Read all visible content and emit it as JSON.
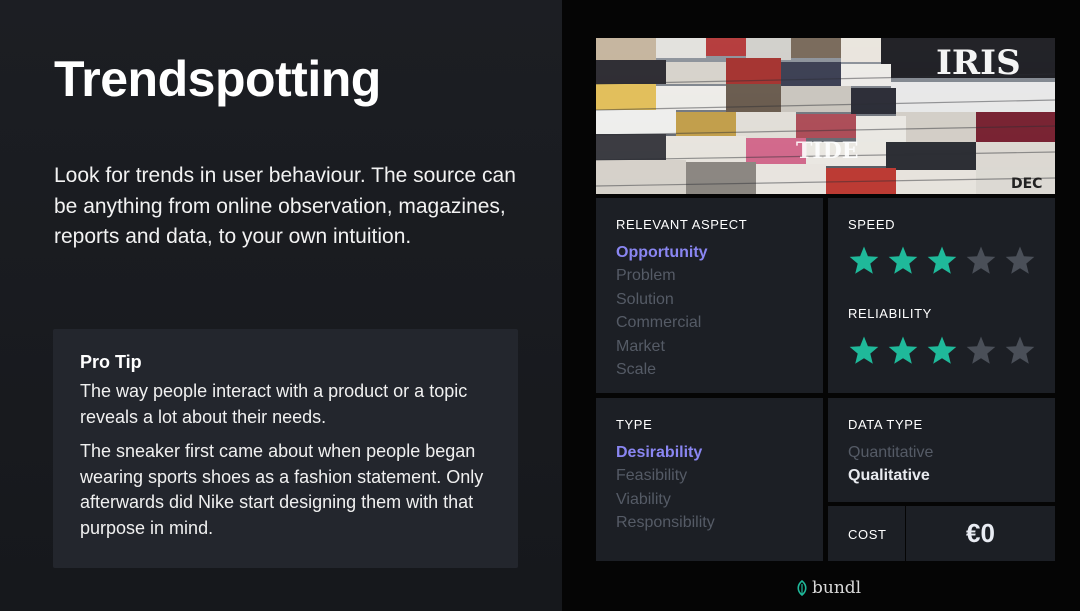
{
  "slide": {
    "title": "Trendspotting",
    "intro": "Look for trends in user behaviour. The source can be anything from online observation, magazines, reports and data, to your own intuition."
  },
  "pro_tip": {
    "title": "Pro Tip",
    "paragraphs": [
      "The way people interact with a product or a topic reveals a lot about their needs.",
      "The sneaker first came about when people began wearing sports shoes as a fashion statement. Only afterwards did Nike start designing them with that purpose in mind."
    ]
  },
  "image": {
    "overlay_text": [
      "IRIS",
      "TIDE",
      "DEC"
    ]
  },
  "relevant_aspect": {
    "label": "RELEVANT ASPECT",
    "options": [
      "Opportunity",
      "Problem",
      "Solution",
      "Commercial",
      "Market",
      "Scale"
    ],
    "selected": "Opportunity"
  },
  "speed": {
    "label": "SPEED",
    "rating": 3,
    "max": 5
  },
  "reliability": {
    "label": "RELIABILITY",
    "rating": 3,
    "max": 5
  },
  "type": {
    "label": "TYPE",
    "options": [
      "Desirability",
      "Feasibility",
      "Viability",
      "Responsibility"
    ],
    "selected": "Desirability"
  },
  "data_type": {
    "label": "DATA TYPE",
    "options": [
      "Quantitative",
      "Qualitative"
    ],
    "selected": "Qualitative"
  },
  "cost": {
    "label": "COST",
    "value": "€0"
  },
  "brand": {
    "name": "bundl"
  },
  "colors": {
    "star_filled": "#1fb99a",
    "star_empty": "#4a4f58",
    "accent": "#8a86f2",
    "muted": "#555b66"
  }
}
